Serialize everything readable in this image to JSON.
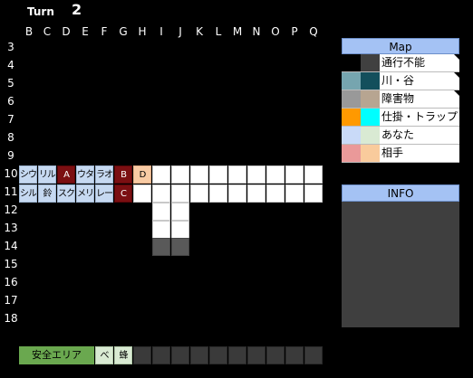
{
  "turn": {
    "label": "Turn",
    "value": "2"
  },
  "columns": [
    "B",
    "C",
    "D",
    "E",
    "F",
    "G",
    "H",
    "I",
    "J",
    "K",
    "L",
    "M",
    "N",
    "O",
    "P",
    "Q"
  ],
  "rows": [
    "3",
    "4",
    "5",
    "6",
    "7",
    "8",
    "9",
    "10",
    "11",
    "12",
    "13",
    "14",
    "15",
    "16",
    "17",
    "18"
  ],
  "grid": {
    "row10": [
      "シウ",
      "リル",
      "A",
      "ウタ",
      "ラオ",
      "B",
      "D",
      "",
      "",
      "",
      "",
      "",
      "",
      "",
      "",
      ""
    ],
    "row11": [
      "シル",
      "鈴",
      "スク",
      "メリ",
      "レー",
      "C",
      "",
      "",
      "",
      "",
      "",
      "",
      "",
      "",
      "",
      ""
    ]
  },
  "legend": {
    "title": "Map",
    "items": [
      {
        "label": "通行不能",
        "colors": [
          "#000000",
          "#404040"
        ]
      },
      {
        "label": "川・谷",
        "colors": [
          "#76a5af",
          "#134f5c"
        ]
      },
      {
        "label": "障害物",
        "colors": [
          "#999999",
          "#b7a591"
        ]
      },
      {
        "label": "仕掛・トラップ",
        "colors": [
          "#ff9900",
          "#00ffff"
        ]
      },
      {
        "label": "あなた",
        "colors": [
          "#c9daf8",
          "#d9ead3"
        ]
      },
      {
        "label": "相手",
        "colors": [
          "#ea9999",
          "#f9cb9c"
        ]
      }
    ]
  },
  "info": {
    "title": "INFO"
  },
  "bottom": {
    "safe_area": "安全エリア",
    "slot1": "べ",
    "slot2": "蜂"
  },
  "colors": {
    "ally": "#c6d9f1",
    "enemy": "#7b0f12",
    "header": "#a4c2f4",
    "safe": "#6aa84f"
  }
}
